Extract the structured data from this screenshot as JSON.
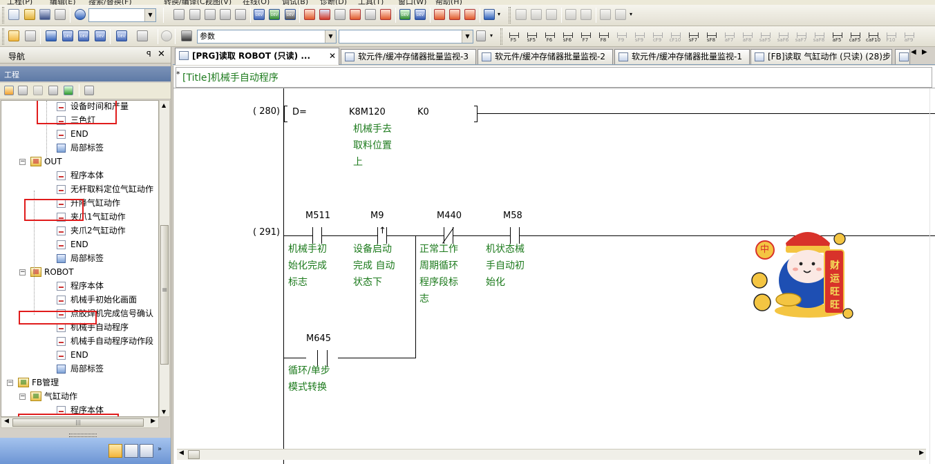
{
  "menu": {
    "items": [
      "工程(P)",
      "编辑(E)",
      "搜索/替换(F)",
      "转换/编译(C)",
      "视图(V)",
      "在线(O)",
      "调试(B)",
      "诊断(D)",
      "工具(T)",
      "窗口(W)",
      "帮助(H)"
    ]
  },
  "toolbar2": {
    "search_combo_value": "参数"
  },
  "fkeys": [
    {
      "label": "F5",
      "dim": false
    },
    {
      "label": "sF5",
      "dim": false
    },
    {
      "label": "F6",
      "dim": false
    },
    {
      "label": "sF6",
      "dim": false
    },
    {
      "label": "F7",
      "dim": false
    },
    {
      "label": "F8",
      "dim": false
    },
    {
      "label": "F9",
      "dim": true
    },
    {
      "label": "sF9",
      "dim": true
    },
    {
      "label": "cF9",
      "dim": true
    },
    {
      "label": "cF10",
      "dim": true
    },
    {
      "label": "sF7",
      "dim": false
    },
    {
      "label": "sF8",
      "dim": false
    },
    {
      "label": "aF7",
      "dim": true
    },
    {
      "label": "aF8",
      "dim": true
    },
    {
      "label": "saF5",
      "dim": true
    },
    {
      "label": "saF6",
      "dim": true
    },
    {
      "label": "saF7",
      "dim": true
    },
    {
      "label": "saF8",
      "dim": true
    },
    {
      "label": "aF5",
      "dim": false
    },
    {
      "label": "caF5",
      "dim": false
    },
    {
      "label": "caF10",
      "dim": false
    },
    {
      "label": "F10",
      "dim": true
    },
    {
      "label": "aF9",
      "dim": true
    }
  ],
  "nav": {
    "title": "导航",
    "pin": "ꟼ",
    "close": "✕",
    "section": "工程",
    "tree": [
      {
        "label": "设备时间和产量",
        "icon": "program",
        "depth": 3
      },
      {
        "label": "三色灯",
        "icon": "program",
        "depth": 3
      },
      {
        "label": "END",
        "icon": "program",
        "depth": 3
      },
      {
        "label": "局部标签",
        "icon": "label",
        "depth": 3
      },
      {
        "label": "OUT",
        "icon": "folder",
        "depth": 2,
        "expander": "−"
      },
      {
        "label": "程序本体",
        "icon": "program",
        "depth": 3
      },
      {
        "label": "无杆取料定位气缸动作",
        "icon": "program",
        "depth": 3
      },
      {
        "label": "升降气缸动作",
        "icon": "program",
        "depth": 3
      },
      {
        "label": "夹爪1气缸动作",
        "icon": "program",
        "depth": 3
      },
      {
        "label": "夹爪2气缸动作",
        "icon": "program",
        "depth": 3
      },
      {
        "label": "END",
        "icon": "program",
        "depth": 3
      },
      {
        "label": "局部标签",
        "icon": "label",
        "depth": 3
      },
      {
        "label": "ROBOT",
        "icon": "folder",
        "depth": 2,
        "expander": "−"
      },
      {
        "label": "程序本体",
        "icon": "program",
        "depth": 3
      },
      {
        "label": "机械手初始化画面",
        "icon": "program",
        "depth": 3
      },
      {
        "label": "点胶焊机完成信号确认",
        "icon": "program",
        "depth": 3
      },
      {
        "label": "机械手自动程序",
        "icon": "program",
        "depth": 3
      },
      {
        "label": "机械手自动程序动作段",
        "icon": "program",
        "depth": 3
      },
      {
        "label": "END",
        "icon": "program",
        "depth": 3
      },
      {
        "label": "局部标签",
        "icon": "label",
        "depth": 3
      },
      {
        "label": "FB管理",
        "icon": "fbfolder",
        "depth": 1,
        "expander": "−"
      },
      {
        "label": "气缸动作",
        "icon": "fbfolder",
        "depth": 2,
        "expander": "−"
      },
      {
        "label": "程序本体",
        "icon": "program",
        "depth": 3
      },
      {
        "label": "局部标签",
        "icon": "label",
        "depth": 3
      }
    ]
  },
  "tabs": [
    {
      "label": "[PRG]读取 ROBOT (只读) ...",
      "active": true,
      "close": "✕"
    },
    {
      "label": "软元件/缓冲存储器批量监视-3",
      "active": false
    },
    {
      "label": "软元件/缓冲存储器批量监视-2",
      "active": false
    },
    {
      "label": "软元件/缓冲存储器批量监视-1",
      "active": false
    },
    {
      "label": "[FB]读取 气缸动作 (只读) (28)步",
      "active": false
    }
  ],
  "tab_nav": {
    "left": "◀",
    "right": "▶"
  },
  "editor": {
    "title_star": "*",
    "title": "[Title]机械手自动程序",
    "rung1": {
      "step": "( 280)",
      "instruction": "D=",
      "operand1": "K8M120",
      "operand2": "K0",
      "comment": [
        "机械手去",
        "取料位置",
        "上"
      ]
    },
    "rung2": {
      "step": "( 291)",
      "contacts": [
        {
          "device": "M511",
          "type": "NO",
          "comment": [
            "机械手初",
            "始化完成",
            "标志"
          ]
        },
        {
          "device": "M9",
          "type": "RISING",
          "comment": [
            "设备启动",
            "完成 自动",
            "状态下"
          ]
        },
        {
          "device": "M440",
          "type": "NC",
          "comment": [
            "正常工作",
            "周期循环",
            "程序段标",
            "志"
          ]
        },
        {
          "device": "M58",
          "type": "NO",
          "comment": [
            "机状态械",
            "手自动初",
            "始化"
          ]
        }
      ],
      "parallel": {
        "device": "M645",
        "comment": [
          "循环/单步",
          "模式转换"
        ]
      }
    }
  },
  "sticker": {
    "glyphs": [
      "中",
      "财",
      "运",
      "旺",
      "旺"
    ]
  }
}
